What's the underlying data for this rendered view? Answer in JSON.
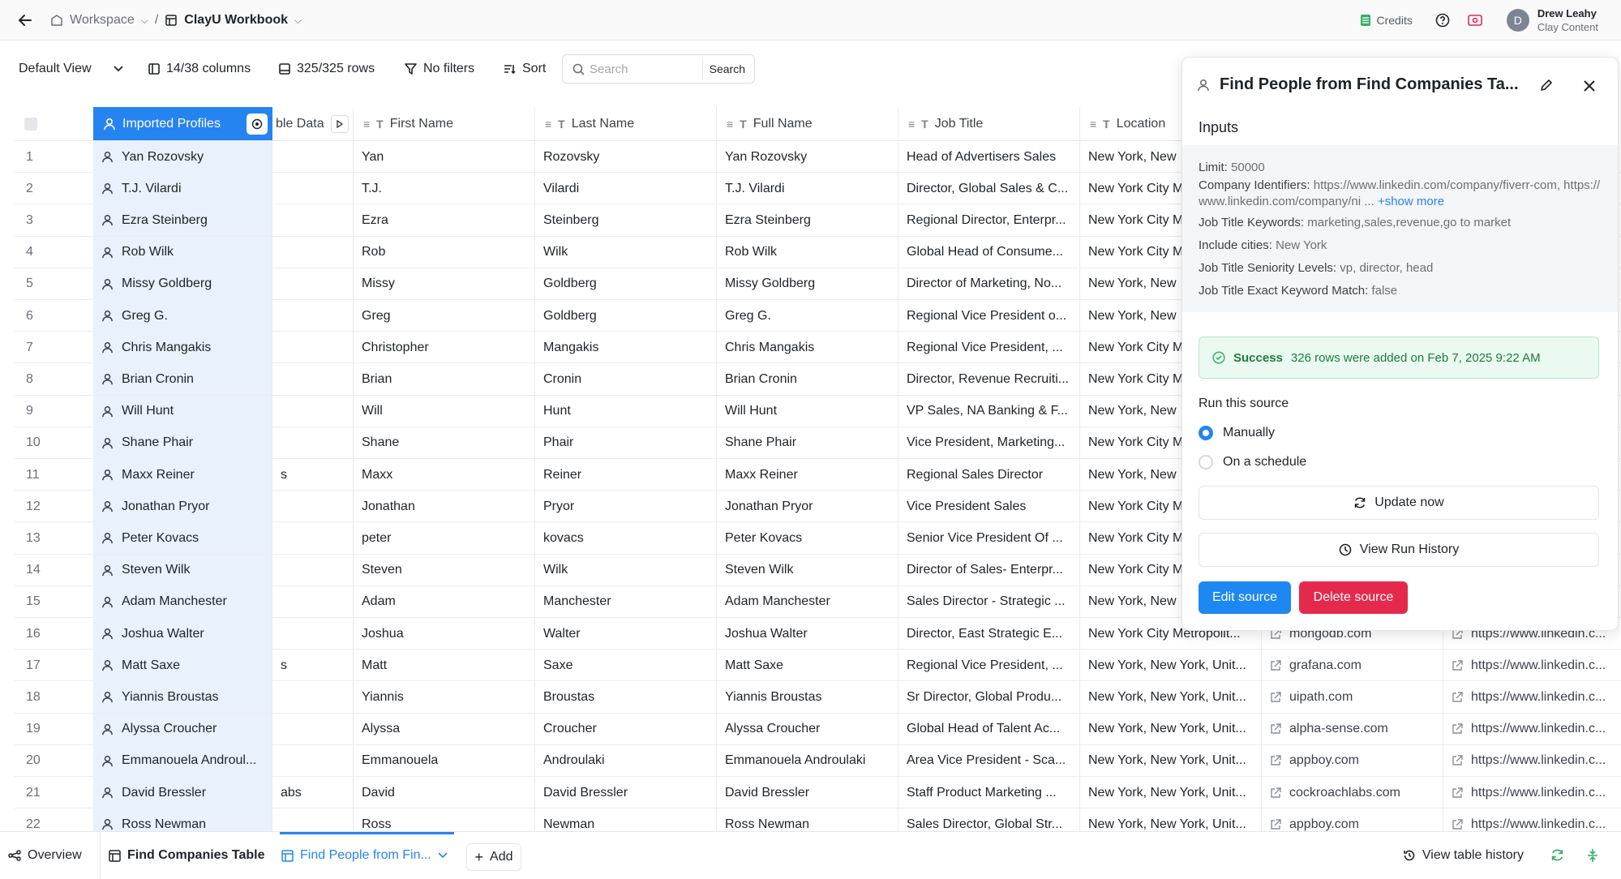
{
  "topbar": {
    "workspace": "Workspace",
    "separator": "/",
    "workbook": "ClayU Workbook",
    "credits": "Credits",
    "user_name": "Drew Leahy",
    "user_org": "Clay Content",
    "avatar_initial": "D"
  },
  "toolbar": {
    "view": "Default View",
    "columns": "14/38 columns",
    "rows": "325/325 rows",
    "filters": "No filters",
    "sort": "Sort",
    "search_placeholder": "Search",
    "search_button": "Search"
  },
  "table": {
    "headers": {
      "profiles": "Imported Profiles",
      "data": "ble Data",
      "first": "First Name",
      "last": "Last Name",
      "full": "Full Name",
      "job": "Job Title",
      "location": "Location"
    },
    "rows": [
      {
        "n": "1",
        "profile": "Yan Rozovsky",
        "data": "",
        "first": "Yan",
        "last": "Rozovsky",
        "full": "Yan Rozovsky",
        "job": "Head of Advertisers Sales",
        "loc": "New York, New",
        "domain": "",
        "li": ""
      },
      {
        "n": "2",
        "profile": "T.J. Vilardi",
        "data": "",
        "first": "T.J.",
        "last": "Vilardi",
        "full": "T.J. Vilardi",
        "job": "Director, Global Sales & C...",
        "loc": "New York City M",
        "domain": "",
        "li": ""
      },
      {
        "n": "3",
        "profile": "Ezra Steinberg",
        "data": "",
        "first": "Ezra",
        "last": "Steinberg",
        "full": "Ezra Steinberg",
        "job": "Regional Director, Enterpr...",
        "loc": "New York City M",
        "domain": "",
        "li": ""
      },
      {
        "n": "4",
        "profile": "Rob Wilk",
        "data": "",
        "first": "Rob",
        "last": "Wilk",
        "full": "Rob Wilk",
        "job": "Global Head of Consume...",
        "loc": "New York City M",
        "domain": "",
        "li": ""
      },
      {
        "n": "5",
        "profile": "Missy Goldberg",
        "data": "",
        "first": "Missy",
        "last": "Goldberg",
        "full": "Missy Goldberg",
        "job": "Director of Marketing, No...",
        "loc": "New York, New",
        "domain": "",
        "li": ""
      },
      {
        "n": "6",
        "profile": "Greg G.",
        "data": "",
        "first": "Greg",
        "last": "Goldberg",
        "full": "Greg G.",
        "job": "Regional Vice President o...",
        "loc": "New York, New",
        "domain": "",
        "li": ""
      },
      {
        "n": "7",
        "profile": "Chris Mangakis",
        "data": "",
        "first": "Christopher",
        "last": "Mangakis",
        "full": "Chris Mangakis",
        "job": "Regional Vice President, ...",
        "loc": "New York City M",
        "domain": "",
        "li": ""
      },
      {
        "n": "8",
        "profile": "Brian Cronin",
        "data": "",
        "first": "Brian",
        "last": "Cronin",
        "full": "Brian Cronin",
        "job": "Director, Revenue Recruiti...",
        "loc": "New York City M",
        "domain": "",
        "li": ""
      },
      {
        "n": "9",
        "profile": "Will Hunt",
        "data": "",
        "first": "Will",
        "last": "Hunt",
        "full": "Will Hunt",
        "job": "VP Sales, NA Banking & F...",
        "loc": "New York, New",
        "domain": "",
        "li": ""
      },
      {
        "n": "10",
        "profile": "Shane Phair",
        "data": "",
        "first": "Shane",
        "last": "Phair",
        "full": "Shane Phair",
        "job": "Vice President, Marketing...",
        "loc": "New York City M",
        "domain": "",
        "li": ""
      },
      {
        "n": "11",
        "profile": "Maxx Reiner",
        "data": "s",
        "first": "Maxx",
        "last": "Reiner",
        "full": "Maxx Reiner",
        "job": "Regional Sales Director",
        "loc": "New York, New",
        "domain": "",
        "li": ""
      },
      {
        "n": "12",
        "profile": "Jonathan Pryor",
        "data": "",
        "first": "Jonathan",
        "last": "Pryor",
        "full": "Jonathan Pryor",
        "job": "Vice President Sales",
        "loc": "New York City M",
        "domain": "",
        "li": ""
      },
      {
        "n": "13",
        "profile": "Peter Kovacs",
        "data": "",
        "first": "peter",
        "last": "kovacs",
        "full": "Peter Kovacs",
        "job": "Senior Vice President Of ...",
        "loc": "New York City M",
        "domain": "",
        "li": ""
      },
      {
        "n": "14",
        "profile": "Steven Wilk",
        "data": "",
        "first": "Steven",
        "last": "Wilk",
        "full": "Steven Wilk",
        "job": "Director of Sales- Enterpr...",
        "loc": "New York City M",
        "domain": "",
        "li": ""
      },
      {
        "n": "15",
        "profile": "Adam Manchester",
        "data": "",
        "first": "Adam",
        "last": "Manchester",
        "full": "Adam Manchester",
        "job": "Sales Director - Strategic ...",
        "loc": "New York, New",
        "domain": "",
        "li": ""
      },
      {
        "n": "16",
        "profile": "Joshua Walter",
        "data": "",
        "first": "Joshua",
        "last": "Walter",
        "full": "Joshua Walter",
        "job": "Director, East Strategic E...",
        "loc": "New York City Metropolit...",
        "domain": "mongodb.com",
        "li": "https://www.linkedin.c..."
      },
      {
        "n": "17",
        "profile": "Matt Saxe",
        "data": "s",
        "first": "Matt",
        "last": "Saxe",
        "full": "Matt Saxe",
        "job": "Regional Vice President, ...",
        "loc": "New York, New York, Unit...",
        "domain": "grafana.com",
        "li": "https://www.linkedin.c..."
      },
      {
        "n": "18",
        "profile": "Yiannis Broustas",
        "data": "",
        "first": "Yiannis",
        "last": "Broustas",
        "full": "Yiannis Broustas",
        "job": "Sr Director, Global Produ...",
        "loc": "New York, New York, Unit...",
        "domain": "uipath.com",
        "li": "https://www.linkedin.c..."
      },
      {
        "n": "19",
        "profile": "Alyssa Croucher",
        "data": "",
        "first": "Alyssa",
        "last": "Croucher",
        "full": "Alyssa Croucher",
        "job": "Global Head of Talent Ac...",
        "loc": "New York, New York, Unit...",
        "domain": "alpha-sense.com",
        "li": "https://www.linkedin.c..."
      },
      {
        "n": "20",
        "profile": "Emmanouela Androul...",
        "data": "",
        "first": "Emmanouela",
        "last": "Androulaki",
        "full": "Emmanouela Androulaki",
        "job": "Area Vice President - Sca...",
        "loc": "New York, New York, Unit...",
        "domain": "appboy.com",
        "li": "https://www.linkedin.c..."
      },
      {
        "n": "21",
        "profile": "David Bressler",
        "data": "abs",
        "first": "David",
        "last": "David Bressler",
        "full": "David Bressler",
        "job": "Staff Product Marketing ...",
        "loc": "New York, New York, Unit...",
        "domain": "cockroachlabs.com",
        "li": "https://www.linkedin.c..."
      },
      {
        "n": "22",
        "profile": "Ross Newman",
        "data": "",
        "first": "Ross",
        "last": "Newman",
        "full": "Ross Newman",
        "job": "Sales Director, Global Str...",
        "loc": "New York, New York, Unit...",
        "domain": "appboy.com",
        "li": "https://www.linkedin.c..."
      }
    ]
  },
  "panel": {
    "title": "Find People from Find Companies Ta...",
    "inputs_label": "Inputs",
    "limit_k": "Limit:",
    "limit_v": "50000",
    "company_k": "Company Identifiers:",
    "company_v": "https://www.linkedin.com/company/fiverr-com, https://www.linkedin.com/company/ni ...",
    "company_more": "+show more",
    "keywords_k": "Job Title Keywords:",
    "keywords_v": "marketing,sales,revenue,go to market",
    "cities_k": "Include cities:",
    "cities_v": "New York",
    "seniority_k": "Job Title Seniority Levels:",
    "seniority_v": "vp, director, head",
    "exact_k": "Job Title Exact Keyword Match:",
    "exact_v": "false",
    "success_label": "Success",
    "success_text": "326 rows were added on Feb 7, 2025 9:22 AM",
    "run_label": "Run this source",
    "opt_manual": "Manually",
    "opt_schedule": "On a schedule",
    "update_btn": "Update now",
    "history_btn": "View Run History",
    "edit_btn": "Edit source",
    "delete_btn": "Delete source"
  },
  "bottombar": {
    "overview": "Overview",
    "tab_companies": "Find Companies Table",
    "tab_people": "Find People from Fin...",
    "add": "Add",
    "history": "View table history"
  },
  "colors": {
    "accent": "#2684f0",
    "danger": "#e5294d",
    "success_bg": "#eafaf0",
    "profile_col": "#e8f1fc"
  }
}
